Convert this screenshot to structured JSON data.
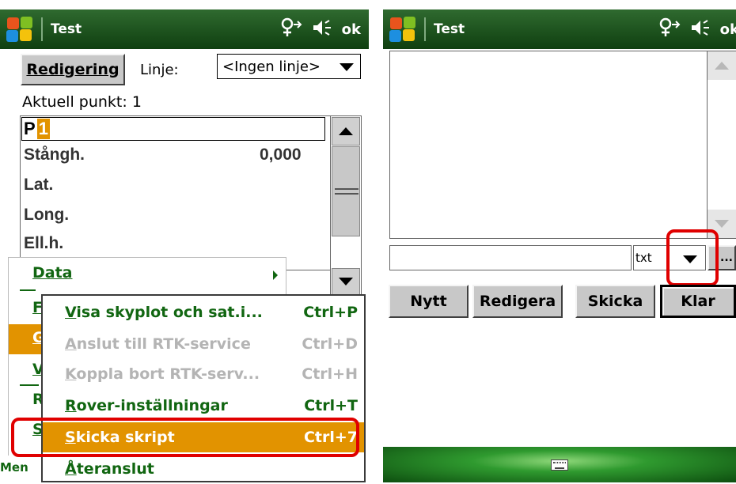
{
  "left": {
    "title": "Test",
    "ok": "ok",
    "edit_button": "Redigering",
    "line_label": "Linje:",
    "line_select": "<Ingen linje>",
    "current_point": "Aktuell punkt: 1",
    "point_prefix": "P",
    "point_value": "1",
    "rows": [
      {
        "label": "Stångh.",
        "value": "0,000"
      },
      {
        "label": "Lat.",
        "value": ""
      },
      {
        "label": "Long.",
        "value": ""
      },
      {
        "label": "Ell.h.",
        "value": ""
      }
    ],
    "menu": {
      "items": [
        {
          "label": "Data",
          "has_submenu": true
        },
        {
          "label": "F",
          "has_submenu": false
        },
        {
          "label": "G",
          "has_submenu": false
        },
        {
          "label": "V",
          "has_submenu": false
        },
        {
          "label": "R",
          "has_submenu": false
        },
        {
          "label": "S",
          "has_submenu": false
        }
      ],
      "bottom_label": "Men"
    },
    "submenu": {
      "items": [
        {
          "label": "Visa skyplot och sat.i...",
          "accel": "V",
          "shortcut": "Ctrl+P",
          "state": "enabled"
        },
        {
          "label": "Anslut till RTK-service",
          "accel": "A",
          "shortcut": "Ctrl+D",
          "state": "disabled"
        },
        {
          "label": "Koppla bort RTK-serv...",
          "accel": "K",
          "shortcut": "Ctrl+H",
          "state": "disabled"
        },
        {
          "label": "Rover-inställningar",
          "accel": "R",
          "shortcut": "Ctrl+T",
          "state": "enabled"
        },
        {
          "label": "Skicka skript",
          "accel": "S",
          "shortcut": "Ctrl+7",
          "state": "selected"
        },
        {
          "label": "Återanslut",
          "accel": "Å",
          "shortcut": "",
          "state": "enabled"
        }
      ]
    }
  },
  "right": {
    "title": "Test",
    "ok": "ok",
    "filetype": "txt",
    "browse": "...",
    "buttons": [
      "Nytt",
      "Redigera",
      "Skicka",
      "Klar"
    ]
  },
  "colors": {
    "titlebar": "#1f5a20",
    "selection": "#e29300",
    "menu_text": "#116611",
    "highlight_box": "#e00000"
  }
}
